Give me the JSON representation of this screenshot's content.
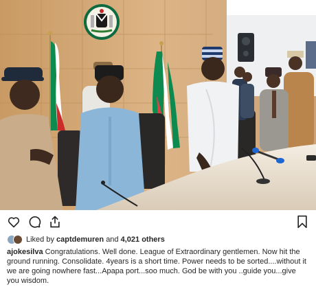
{
  "post": {
    "photo_alt": "",
    "seal_motto": "UNITY AND FAITH, PEACE AND PROGRESS"
  },
  "actions": {
    "like_icon": "heart-icon",
    "comment_icon": "comment-icon",
    "share_icon": "share-icon",
    "save_icon": "bookmark-icon"
  },
  "likes": {
    "prefix": "Liked by",
    "user": "captdemuren",
    "connector": "and",
    "count_text": "4,021 others"
  },
  "caption": {
    "username": "ajokesilva",
    "text": "Congratulations. Well done. League of Extraordinary gentlemen. Now hit the ground running. Consolidate. 4years is a short time. Power needs to be sorted....without it we are going nowhere fast...Apapa port...soo much. God be with you ..guide you...give you wisdom."
  },
  "colors": {
    "nigeria_green": "#008751",
    "wall": "#d9b07a",
    "table": "#efe7db"
  }
}
